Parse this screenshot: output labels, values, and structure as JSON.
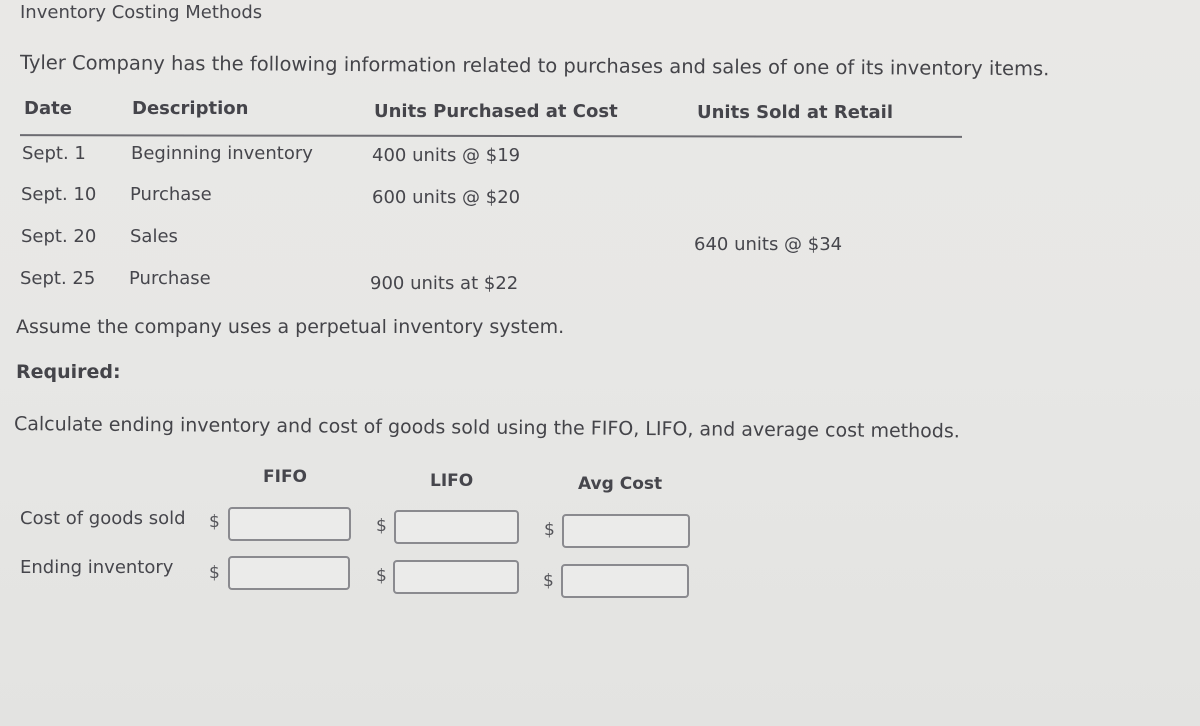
{
  "title": "Inventory Costing Methods",
  "intro": "Tyler Company has the following information related to purchases and sales of one of its inventory items.",
  "table": {
    "headers": [
      "Date",
      "Description",
      "Units Purchased at Cost",
      "Units Sold at Retail"
    ],
    "rows": [
      {
        "date": "Sept. 1",
        "description": "Beginning inventory",
        "purchased": "400 units @ $19",
        "sold": ""
      },
      {
        "date": "Sept. 10",
        "description": "Purchase",
        "purchased": "600 units @ $20",
        "sold": ""
      },
      {
        "date": "Sept. 20",
        "description": "Sales",
        "purchased": "",
        "sold": "640 units @ $34"
      },
      {
        "date": "Sept. 25",
        "description": "Purchase",
        "purchased": "900 units at $22",
        "sold": ""
      }
    ]
  },
  "assumption": "Assume the company uses a perpetual inventory system.",
  "required_label": "Required:",
  "instruction": "Calculate ending inventory and cost of goods sold using the FIFO, LIFO, and average cost methods.",
  "answer": {
    "columns": [
      "FIFO",
      "LIFO",
      "Avg Cost"
    ],
    "currency_symbol": "$",
    "rows": [
      {
        "label": "Cost of goods sold",
        "values": [
          "",
          "",
          ""
        ]
      },
      {
        "label": "Ending inventory",
        "values": [
          "",
          "",
          ""
        ]
      }
    ]
  }
}
